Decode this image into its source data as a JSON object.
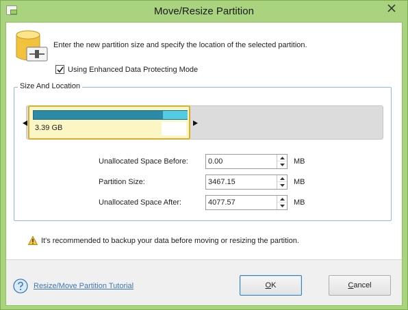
{
  "window": {
    "title": "Move/Resize Partition"
  },
  "dialog": {
    "intro_text": "Enter the new partition size and specify the location of the selected partition.",
    "enhanced_mode": {
      "label": "Using Enhanced Data Protecting Mode",
      "checked": true
    }
  },
  "size_location": {
    "group_title": "Size And Location",
    "partition_label": "3.39 GB",
    "fields": [
      {
        "label": "Unallocated Space Before:",
        "value": "0.00",
        "unit": "MB"
      },
      {
        "label": "Partition Size:",
        "value": "3467.15",
        "unit": "MB"
      },
      {
        "label": "Unallocated Space After:",
        "value": "4077.57",
        "unit": "MB"
      }
    ]
  },
  "warning_text": "It's recommended to backup your data before moving or resizing the partition.",
  "footer": {
    "tutorial_link": "Resize/Move Partition Tutorial",
    "ok_label": "OK",
    "cancel_label": "Cancel"
  },
  "colors": {
    "title_bar": "#a9d37e",
    "partition_fill": "#fbf6c4",
    "partition_border": "#d9ad31",
    "used_space": "#2c8aa7",
    "disk_bar": "#dcdcdc",
    "link": "#3a78b8"
  }
}
